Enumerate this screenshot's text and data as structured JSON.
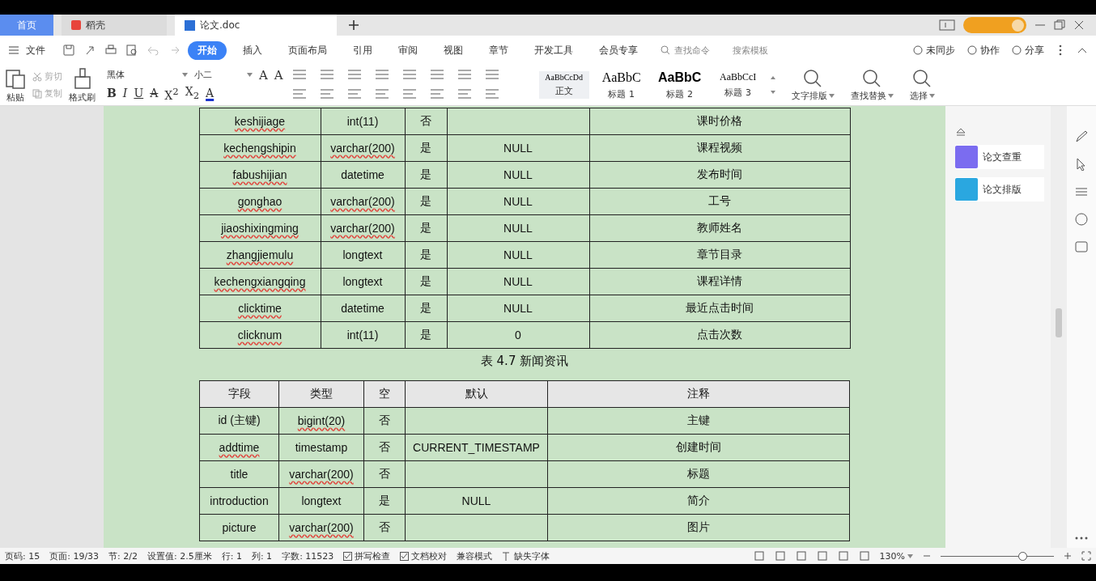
{
  "tabs": [
    {
      "label": "首页",
      "kind": "home",
      "selected": false
    },
    {
      "label": "稻壳",
      "kind": "docer",
      "selected": false
    },
    {
      "label": "论文.doc",
      "kind": "doc",
      "selected": true
    }
  ],
  "menu": {
    "file": "文件",
    "ribbon_tabs": [
      {
        "label": "开始",
        "selected": true
      },
      {
        "label": "插入",
        "selected": false
      },
      {
        "label": "页面布局",
        "selected": false
      },
      {
        "label": "引用",
        "selected": false
      },
      {
        "label": "审阅",
        "selected": false
      },
      {
        "label": "视图",
        "selected": false
      },
      {
        "label": "章节",
        "selected": false
      },
      {
        "label": "开发工具",
        "selected": false
      },
      {
        "label": "会员专享",
        "selected": false
      }
    ],
    "search": {
      "placeholder": "查找命令"
    },
    "template_search": "搜索模板",
    "actions": [
      "未同步",
      "协作",
      "分享"
    ]
  },
  "ribbon": {
    "paste": "粘贴",
    "cut": {
      "label": "剪切",
      "disabled": true
    },
    "copy": {
      "label": "复制",
      "disabled": true
    },
    "format_painter": "格式刷",
    "font": "黑体",
    "size": "小二",
    "size_buttons": [
      "A",
      "A"
    ],
    "format_buttons": [
      {
        "label": "B",
        "kind": "bold"
      },
      {
        "label": "I",
        "kind": "italic"
      },
      {
        "label": "U",
        "kind": "underline"
      },
      {
        "label": "A",
        "kind": "strike"
      },
      {
        "label": "X$^{2}$",
        "kind": "plain"
      },
      {
        "label": "X$_{2}$",
        "kind": "plain"
      },
      {
        "label": "A",
        "kind": "color"
      }
    ],
    "styles": [
      {
        "preview": "AaBbCcDd",
        "label": "正文",
        "selected": true
      },
      {
        "preview": "AaBbC",
        "label": "标题 1",
        "selected": false
      },
      {
        "preview": "AaBbC",
        "label": "标题 2",
        "selected": false
      },
      {
        "preview": "AaBbCcI",
        "label": "标题 3",
        "selected": false
      }
    ],
    "tools": [
      "文字排版",
      "查找替换",
      "选择"
    ]
  },
  "table_1": {
    "rows": [
      {
        "cells": [
          "keshijiage",
          "int(11)",
          "否",
          "",
          "课时价格"
        ],
        "flagged": [
          true,
          false,
          false,
          false,
          false
        ]
      },
      {
        "cells": [
          "kechengshipin",
          "varchar(200)",
          "是",
          "NULL",
          "课程视频"
        ],
        "flagged": [
          true,
          true,
          false,
          false,
          false
        ]
      },
      {
        "cells": [
          "fabushijian",
          "datetime",
          "是",
          "NULL",
          "发布时间"
        ],
        "flagged": [
          true,
          false,
          false,
          false,
          false
        ]
      },
      {
        "cells": [
          "gonghao",
          "varchar(200)",
          "是",
          "NULL",
          "工号"
        ],
        "flagged": [
          true,
          true,
          false,
          false,
          false
        ]
      },
      {
        "cells": [
          "jiaoshixingming",
          "varchar(200)",
          "是",
          "NULL",
          "教师姓名"
        ],
        "flagged": [
          true,
          true,
          false,
          false,
          false
        ]
      },
      {
        "cells": [
          "zhangjiemulu",
          "longtext",
          "是",
          "NULL",
          "章节目录"
        ],
        "flagged": [
          true,
          false,
          false,
          false,
          false
        ]
      },
      {
        "cells": [
          "kechengxiangqing",
          "longtext",
          "是",
          "NULL",
          "课程详情"
        ],
        "flagged": [
          true,
          false,
          false,
          false,
          false
        ]
      },
      {
        "cells": [
          "clicktime",
          "datetime",
          "是",
          "NULL",
          "最近点击时间"
        ],
        "flagged": [
          true,
          false,
          false,
          false,
          false
        ]
      },
      {
        "cells": [
          "clicknum",
          "int(11)",
          "是",
          "0",
          "点击次数"
        ],
        "flagged": [
          true,
          false,
          false,
          false,
          false
        ]
      }
    ]
  },
  "caption": "表 4.7  新闻资讯",
  "table_2": {
    "columns": [
      "字段",
      "类型",
      "空",
      "默认",
      "注释"
    ],
    "rows": [
      {
        "cells": [
          "id (主键)",
          "bigint(20)",
          "否",
          "",
          "主键"
        ],
        "flagged": [
          false,
          true,
          false,
          false,
          false
        ]
      },
      {
        "cells": [
          "addtime",
          "timestamp",
          "否",
          "CURRENT_TIMESTAMP",
          "创建时间"
        ],
        "flagged": [
          true,
          false,
          false,
          false,
          false
        ]
      },
      {
        "cells": [
          "title",
          "varchar(200)",
          "否",
          "",
          "标题"
        ],
        "flagged": [
          false,
          true,
          false,
          false,
          false
        ]
      },
      {
        "cells": [
          "introduction",
          "longtext",
          "是",
          "NULL",
          "简介"
        ],
        "flagged": [
          false,
          false,
          false,
          false,
          false
        ]
      },
      {
        "cells": [
          "picture",
          "varchar(200)",
          "否",
          "",
          "图片"
        ],
        "flagged": [
          false,
          true,
          false,
          false,
          false
        ]
      }
    ]
  },
  "side_panel": [
    "论文查重",
    "论文排版"
  ],
  "status_bar": {
    "items": [
      "页码: 15",
      "页面: 19/33",
      "节: 2/2",
      "设置值: 2.5厘米",
      "行: 1",
      "列: 1",
      "字数: 11523"
    ],
    "checks": [
      "拼写检查",
      "文档校对"
    ],
    "mode": "兼容模式",
    "fonts": "缺失字体",
    "zoom": "130%",
    "zoom_slider": {
      "level": 0.72
    }
  }
}
